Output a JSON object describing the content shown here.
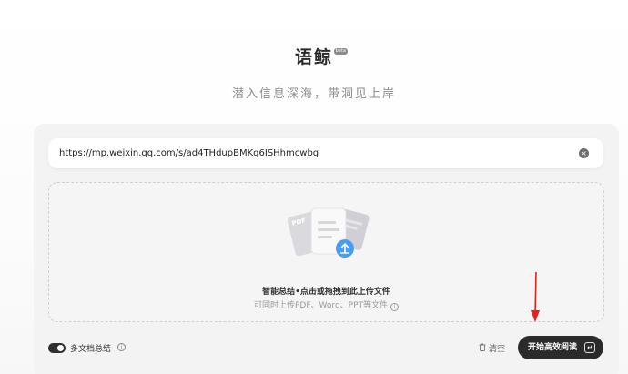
{
  "header": {
    "title": "语鲸",
    "badge": "beta",
    "subtitle": "潜入信息深海，带洞见上岸"
  },
  "url_bar": {
    "value": "https://mp.weixin.qq.com/s/ad4THdupBMKg6ISHhmcwbg",
    "clear_glyph": "×"
  },
  "dropzone": {
    "main_text": "智能总结•点击或拖拽到此上传文件",
    "sub_text": "可同时上传PDF、Word、PPT等文件",
    "info_glyph": "i",
    "illustration_tag": "PDF"
  },
  "bottom": {
    "multi_doc_label": "多文档总结",
    "multi_doc_enabled": true,
    "info_glyph": "i",
    "clear_label": "清空",
    "start_label": "开始高效阅读"
  },
  "colors": {
    "annotation_arrow": "#e0241b",
    "primary_button": "#2b2b2b",
    "upload_badge": "#4a9cf0"
  }
}
